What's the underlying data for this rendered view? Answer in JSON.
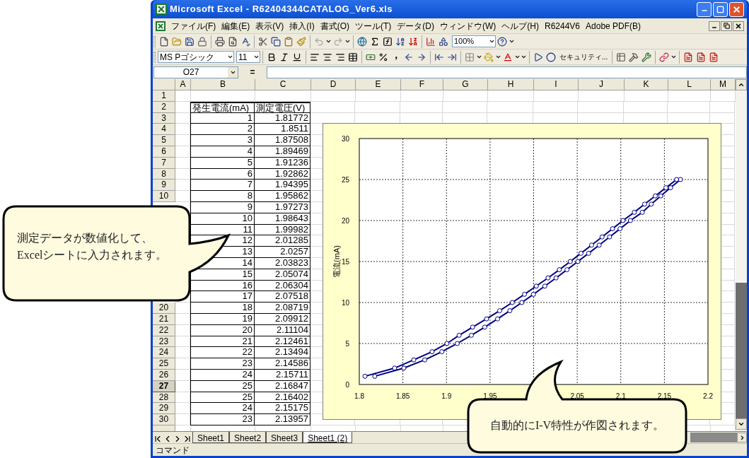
{
  "window": {
    "title": "Microsoft Excel - R62404344CATALOG_Ver6.xls"
  },
  "menu": [
    "ファイル(F)",
    "編集(E)",
    "表示(V)",
    "挿入(I)",
    "書式(O)",
    "ツール(T)",
    "データ(D)",
    "ウィンドウ(W)",
    "ヘルプ(H)",
    "R6244V6",
    "Adobe PDF(B)"
  ],
  "toolbar_standard": {
    "zoom": "100%"
  },
  "toolbar_format": {
    "font": "MS Pゴシック",
    "size": "11",
    "security": "セキュリティ..."
  },
  "formula_bar": {
    "name_box": "O27",
    "equals": "="
  },
  "columns": [
    "A",
    "B",
    "C",
    "D",
    "E",
    "F",
    "G",
    "H",
    "I",
    "J",
    "K",
    "L",
    "M"
  ],
  "row_headers_top": [
    {
      "label": "1",
      "selected": false
    },
    {
      "label": "2",
      "selected": false
    },
    {
      "label": "3",
      "selected": false
    },
    {
      "label": "4",
      "selected": false
    },
    {
      "label": "5",
      "selected": false
    },
    {
      "label": "6",
      "selected": false
    },
    {
      "label": "7",
      "selected": false
    },
    {
      "label": "8",
      "selected": false
    },
    {
      "label": "9",
      "selected": false
    },
    {
      "label": "10",
      "selected": false
    }
  ],
  "row_headers_bottom": [
    {
      "label": "20",
      "selected": false
    },
    {
      "label": "21",
      "selected": false
    },
    {
      "label": "22",
      "selected": false
    },
    {
      "label": "23",
      "selected": false
    },
    {
      "label": "24",
      "selected": false
    },
    {
      "label": "25",
      "selected": false
    },
    {
      "label": "26",
      "selected": false
    },
    {
      "label": "27",
      "selected": true
    },
    {
      "label": "28",
      "selected": false
    },
    {
      "label": "29",
      "selected": false
    },
    {
      "label": "30",
      "selected": false
    }
  ],
  "table": {
    "header": [
      "発生電流(mA)",
      "測定電圧(V)"
    ],
    "rows": [
      {
        "b": "1",
        "c": "1.81772"
      },
      {
        "b": "2",
        "c": "1.8511"
      },
      {
        "b": "3",
        "c": "1.87508"
      },
      {
        "b": "4",
        "c": "1.89469"
      },
      {
        "b": "5",
        "c": "1.91236"
      },
      {
        "b": "6",
        "c": "1.92862"
      },
      {
        "b": "7",
        "c": "1.94395"
      },
      {
        "b": "8",
        "c": "1.95862"
      },
      {
        "b": "9",
        "c": "1.97273"
      },
      {
        "b": "10",
        "c": "1.98643"
      },
      {
        "b": "11",
        "c": "1.99982"
      },
      {
        "b": "12",
        "c": "2.01285"
      },
      {
        "b": "13",
        "c": "2.0257"
      },
      {
        "b": "14",
        "c": "2.03823"
      },
      {
        "b": "15",
        "c": "2.05074"
      },
      {
        "b": "16",
        "c": "2.06304"
      },
      {
        "b": "17",
        "c": "2.07518"
      },
      {
        "b": "18",
        "c": "2.08719"
      },
      {
        "b": "19",
        "c": "2.09912"
      },
      {
        "b": "20",
        "c": "2.11104"
      },
      {
        "b": "21",
        "c": "2.12461"
      },
      {
        "b": "22",
        "c": "2.13494"
      },
      {
        "b": "23",
        "c": "2.14586"
      },
      {
        "b": "24",
        "c": "2.15711"
      },
      {
        "b": "25",
        "c": "2.16847"
      },
      {
        "b": "25",
        "c": "2.16402"
      },
      {
        "b": "24",
        "c": "2.15175"
      },
      {
        "b": "23",
        "c": "2.13957"
      }
    ]
  },
  "chart": {
    "chart_data": {
      "type": "line",
      "ylabel": "電流(mA)",
      "grid": true,
      "x": [
        1.81772,
        1.8511,
        1.87508,
        1.89469,
        1.91236,
        1.92862,
        1.94395,
        1.95862,
        1.97273,
        1.98643,
        1.99982,
        2.01285,
        2.0257,
        2.03823,
        2.05074,
        2.06304,
        2.07518,
        2.08719,
        2.09912,
        2.11104,
        2.12461,
        2.13494,
        2.14586,
        2.15711,
        2.16847,
        2.16402,
        2.15175,
        2.13957,
        2.12732,
        2.1155,
        2.1025,
        2.0905,
        2.0785,
        2.0665,
        2.0543,
        2.042,
        2.0295,
        2.0165,
        2.003,
        1.9895,
        1.9755,
        1.961,
        1.946,
        1.93,
        1.9145,
        1.9005,
        1.8835,
        1.8625,
        1.8405,
        1.8065
      ],
      "series": [
        {
          "color": "#000080",
          "marker": "circle",
          "values": [
            1,
            2,
            3,
            4,
            5,
            6,
            7,
            8,
            9,
            10,
            11,
            12,
            13,
            14,
            15,
            16,
            17,
            18,
            19,
            20,
            21,
            22,
            23,
            24,
            25,
            25,
            24,
            23,
            22,
            21,
            20,
            19,
            18,
            17,
            16,
            15,
            14,
            13,
            12,
            11,
            10,
            9,
            8,
            7,
            6,
            5,
            4,
            3,
            2,
            1
          ]
        }
      ],
      "xlim": [
        1.8,
        2.2
      ],
      "ylim": [
        0,
        30
      ],
      "xticks": [
        {
          "value": 1.8,
          "label": "1.8"
        },
        {
          "value": 1.85,
          "label": "1.85"
        },
        {
          "value": 1.9,
          "label": "1.9"
        },
        {
          "value": 1.95,
          "label": "1.95"
        },
        {
          "value": 2.05,
          "label": "2.05"
        },
        {
          "value": 2.1,
          "label": "2.1"
        },
        {
          "value": 2.15,
          "label": "2.15"
        },
        {
          "value": 2.2,
          "label": "2.2"
        }
      ],
      "yticks": [
        0,
        5,
        10,
        15,
        20,
        25,
        30
      ]
    }
  },
  "sheet_tabs": [
    {
      "label": "Sheet1",
      "selected": false
    },
    {
      "label": "Sheet2",
      "selected": false
    },
    {
      "label": "Sheet3",
      "selected": false
    },
    {
      "label": "Sheet1 (2)",
      "selected": true
    }
  ],
  "status_bar": "コマンド",
  "callouts": [
    {
      "lines": [
        "測定データが数値化して、",
        "Excelシートに入力されます。"
      ]
    },
    {
      "lines": [
        "自動的にI-V特性が作図されます。"
      ]
    }
  ]
}
